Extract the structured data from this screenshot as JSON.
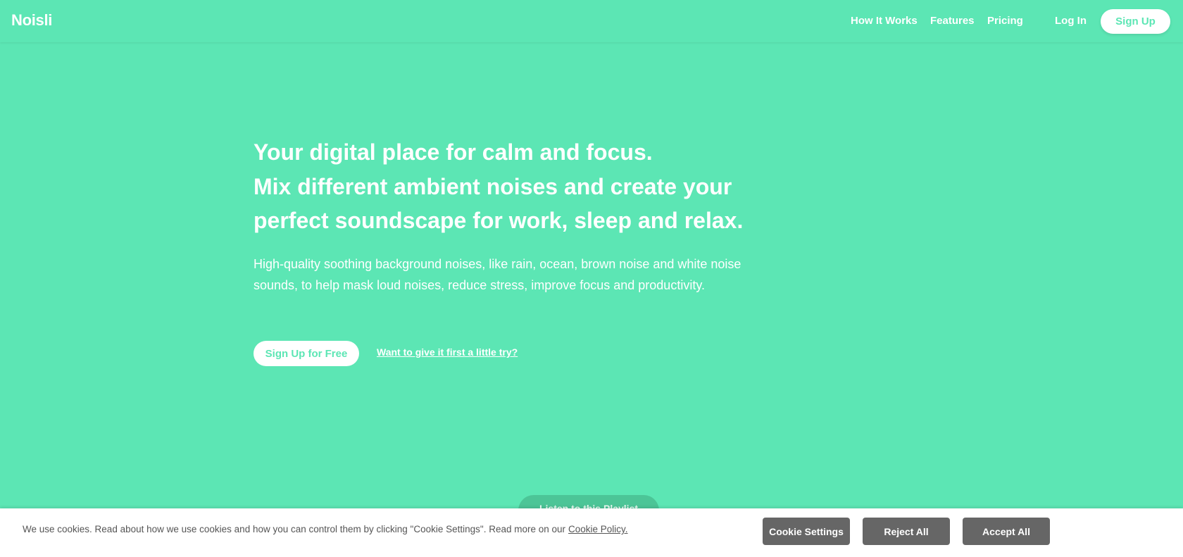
{
  "nav": {
    "logo": "Noisli",
    "links": [
      "How It Works",
      "Features",
      "Pricing"
    ],
    "login": "Log In",
    "signup": "Sign Up"
  },
  "hero": {
    "headline": [
      "Your digital place for calm and focus.",
      "Mix different ambient noises and create your",
      "perfect soundscape for work, sleep and relax."
    ],
    "description": "High-quality soothing background noises, like rain, ocean, brown noise and white noise sounds, to help mask loud noises, reduce stress, improve focus and productivity.",
    "cta": "Sign Up for Free",
    "try_link": "Want to give it first a little try?"
  },
  "playlist_button": "Listen to this Playlist",
  "cookie": {
    "text": "We use cookies. Read about how we use cookies and how you can control them by clicking \"Cookie Settings\". Read more on our",
    "policy_link": "Cookie Policy.",
    "settings": "Cookie Settings",
    "reject": "Reject All",
    "accept": "Accept All"
  },
  "colors": {
    "brand": "#5ce6b4",
    "cookie_button": "#666666"
  }
}
